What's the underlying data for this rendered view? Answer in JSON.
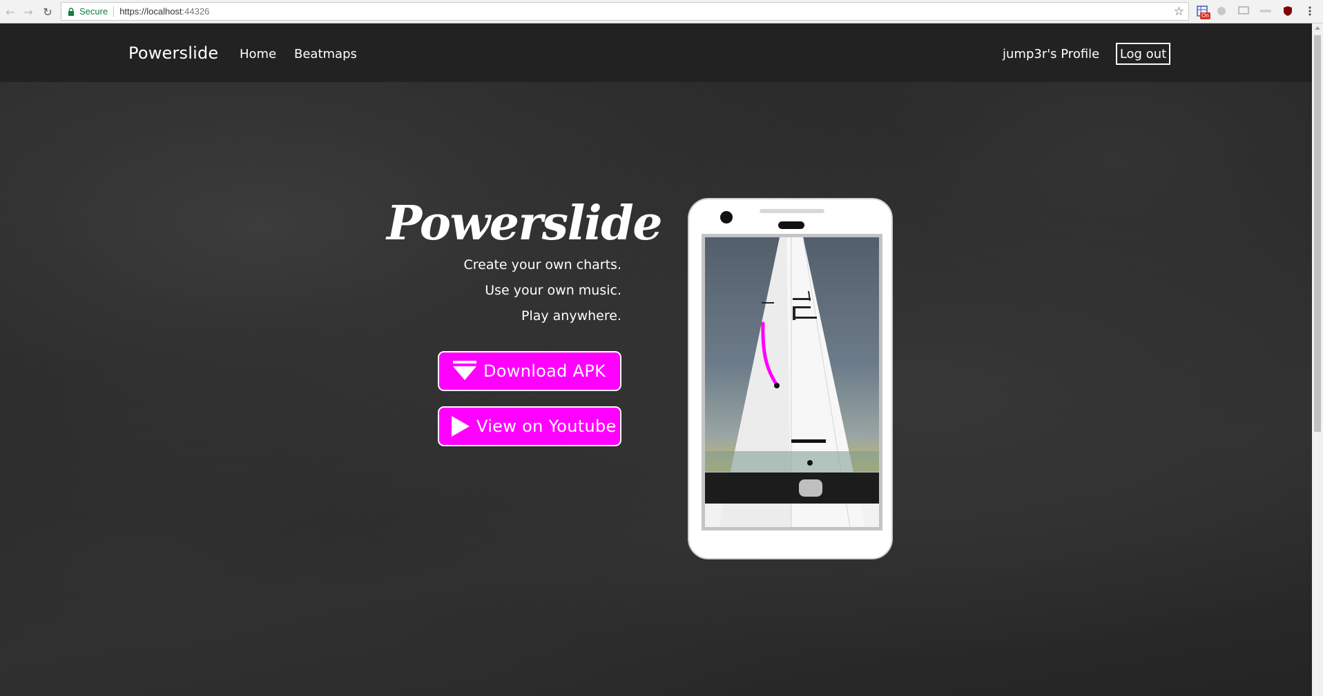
{
  "browser": {
    "secure_label": "Secure",
    "url_scheme": "https://",
    "url_host": "localhost",
    "url_port": ":44326",
    "ext_badge": "On"
  },
  "navbar": {
    "brand": "Powerslide",
    "links": [
      "Home",
      "Beatmaps"
    ],
    "profile_label": "jump3r's Profile",
    "logout_label": "Log out"
  },
  "hero": {
    "title": "Powerslide",
    "taglines": [
      "Create your own charts.",
      "Use your own music.",
      "Play anywhere."
    ],
    "download_label": "Download APK",
    "youtube_label": "View on Youtube"
  },
  "colors": {
    "accent": "#ff00ff",
    "navbar": "#222222"
  },
  "icons": {
    "download": "download-triangle-icon",
    "youtube": "play-icon"
  }
}
